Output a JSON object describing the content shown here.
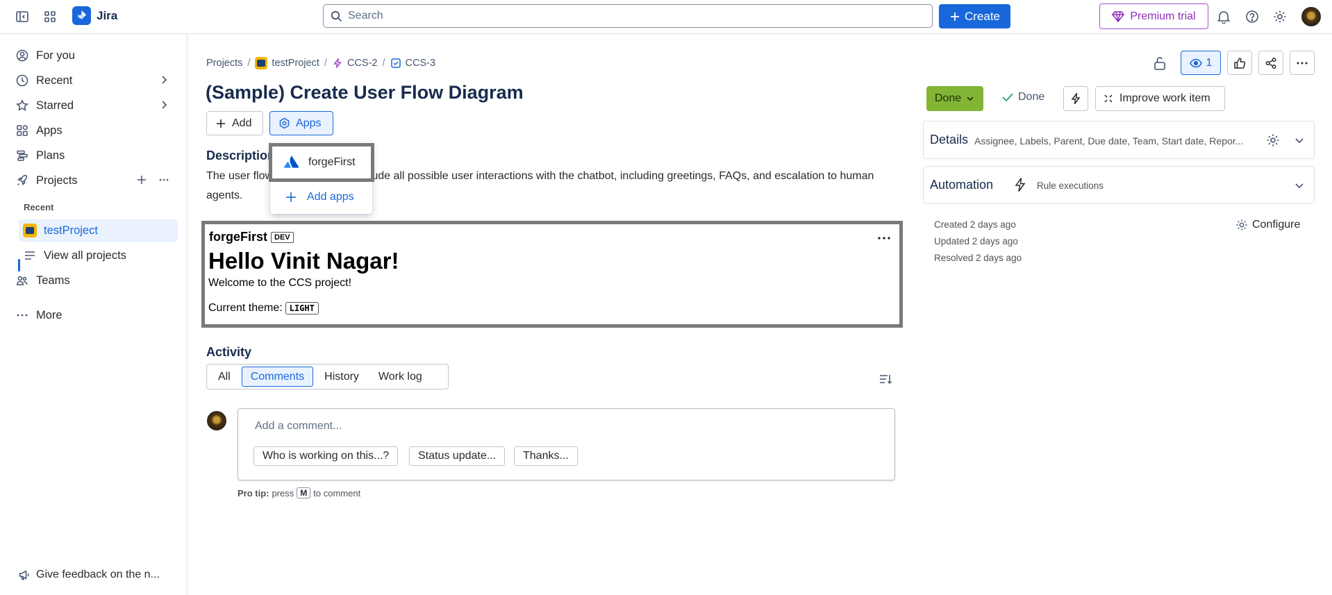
{
  "app": {
    "name": "Jira"
  },
  "search": {
    "placeholder": "Search"
  },
  "topbar": {
    "create_label": "Create",
    "premium_label": "Premium trial"
  },
  "sidebar": {
    "for_you": "For you",
    "recent": "Recent",
    "starred": "Starred",
    "apps": "Apps",
    "plans": "Plans",
    "projects": "Projects",
    "recent_section": "Recent",
    "project_name": "testProject",
    "view_all": "View all projects",
    "teams": "Teams",
    "more": "More",
    "feedback": "Give feedback on the n..."
  },
  "breadcrumbs": {
    "projects": "Projects",
    "project": "testProject",
    "parent": "CCS-2",
    "current": "CCS-3"
  },
  "issue": {
    "title": "(Sample) Create User Flow Diagram",
    "add_label": "Add",
    "apps_label": "Apps",
    "description_heading": "Description",
    "description_text": "The user flow diagram should include all possible user interactions with the chatbot, including greetings, FAQs, and escalation to human agents."
  },
  "apps_dropdown": {
    "app_item": "forgeFirst",
    "add_apps": "Add apps"
  },
  "forge_panel": {
    "app_name": "forgeFirst",
    "env_badge": "DEV",
    "greeting": "Hello Vinit Nagar!",
    "welcome": "Welcome to the CCS project!",
    "theme_label": "Current theme:",
    "theme_value": "LIGHT"
  },
  "activity": {
    "heading": "Activity",
    "tabs": [
      "All",
      "Comments",
      "History",
      "Work log"
    ],
    "active_tab": "Comments",
    "comment_placeholder": "Add a comment...",
    "chips": [
      "Who is working on this...?",
      "Status update...",
      "Thanks..."
    ],
    "protip_label": "Pro tip:",
    "protip_press": "press",
    "protip_key": "M",
    "protip_suffix": "to comment"
  },
  "right": {
    "watch_count": "1",
    "status": "Done",
    "resolution": "Done",
    "improve_label": "Improve work item",
    "details_title": "Details",
    "details_sub": "Assignee, Labels, Parent, Due date, Team, Start date, Repor...",
    "automation_title": "Automation",
    "automation_sub": "Rule executions",
    "created": "Created 2 days ago",
    "updated": "Updated 2 days ago",
    "resolved": "Resolved 2 days ago",
    "configure_label": "Configure"
  },
  "colors": {
    "brand": "#1868db",
    "status_done": "#82b536",
    "premium": "#8f2fb8",
    "highlight_border": "#7a7a7a"
  }
}
